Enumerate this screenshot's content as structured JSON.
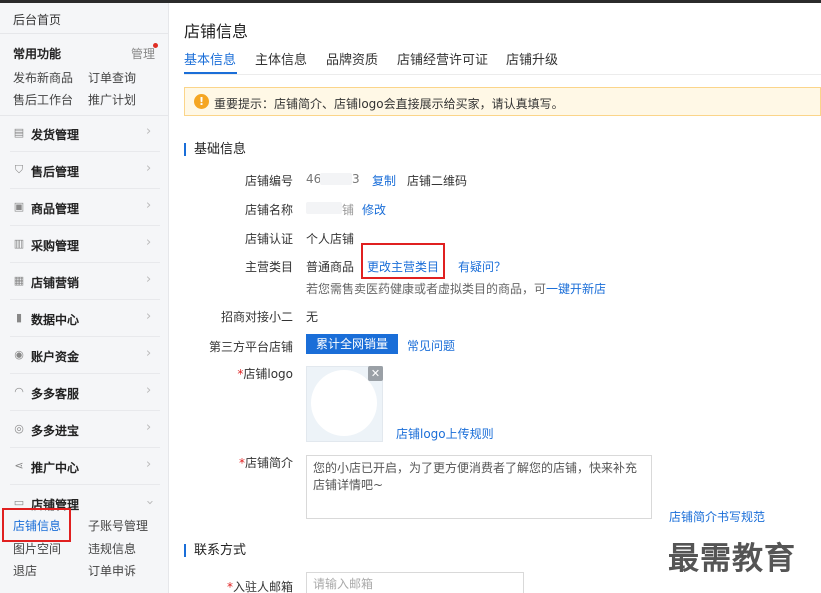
{
  "sidebar": {
    "home": "后台首页",
    "common": {
      "title": "常用功能",
      "manage": "管理"
    },
    "quick_links": [
      "发布新商品",
      "订单查询",
      "售后工作台",
      "推广计划"
    ],
    "menu": [
      {
        "label": "发货管理",
        "icon": "doc-icon"
      },
      {
        "label": "售后管理",
        "icon": "shield-check-icon"
      },
      {
        "label": "商品管理",
        "icon": "box-icon"
      },
      {
        "label": "采购管理",
        "icon": "cart-icon"
      },
      {
        "label": "店铺营销",
        "icon": "calendar-icon"
      },
      {
        "label": "数据中心",
        "icon": "bar-chart-icon"
      },
      {
        "label": "账户资金",
        "icon": "coin-icon"
      },
      {
        "label": "多多客服",
        "icon": "headset-icon"
      },
      {
        "label": "多多进宝",
        "icon": "gift-icon"
      },
      {
        "label": "推广中心",
        "icon": "share-icon"
      },
      {
        "label": "店铺管理",
        "icon": "store-icon"
      }
    ],
    "store_sub": [
      "店铺信息",
      "子账号管理",
      "图片空间",
      "违规信息",
      "退店",
      "订单申诉"
    ]
  },
  "main": {
    "title": "店铺信息",
    "tabs": [
      "基本信息",
      "主体信息",
      "品牌资质",
      "店铺经营许可证",
      "店铺升级"
    ],
    "notice": "重要提示：店铺简介、店铺logo会直接展示给买家，请认真填写。",
    "basic_section": "基础信息",
    "store_id": {
      "label": "店铺编号",
      "value_start": "46",
      "value_end": "3",
      "copy": "复制",
      "qrcode": "店铺二维码"
    },
    "store_name": {
      "label": "店铺名称",
      "value_end": "铺",
      "edit": "修改"
    },
    "certification": {
      "label": "店铺认证",
      "value": "个人店铺"
    },
    "category": {
      "label": "主营类目",
      "value": "普通商品",
      "change": "更改主营类目",
      "question": "有疑问？",
      "hint_prefix": "若您需售卖医药健康或者虚拟类目的商品，可",
      "hint_link": "一键开新店"
    },
    "liaison": {
      "label": "招商对接小二",
      "value": "无"
    },
    "third_party": {
      "label": "第三方平台店铺",
      "button": "累计全网销量",
      "faq": "常见问题"
    },
    "logo": {
      "label": "店铺logo",
      "rules": "店铺logo上传规则"
    },
    "intro": {
      "label": "店铺简介",
      "value": "您的小店已开启，为了更方便消费者了解您的店铺，快来补充店铺详情吧~",
      "guide": "店铺简介书写规范"
    },
    "contact_section": "联系方式",
    "email": {
      "label": "入驻人邮箱",
      "placeholder": "请输入邮箱"
    }
  },
  "watermark": "最需教育"
}
